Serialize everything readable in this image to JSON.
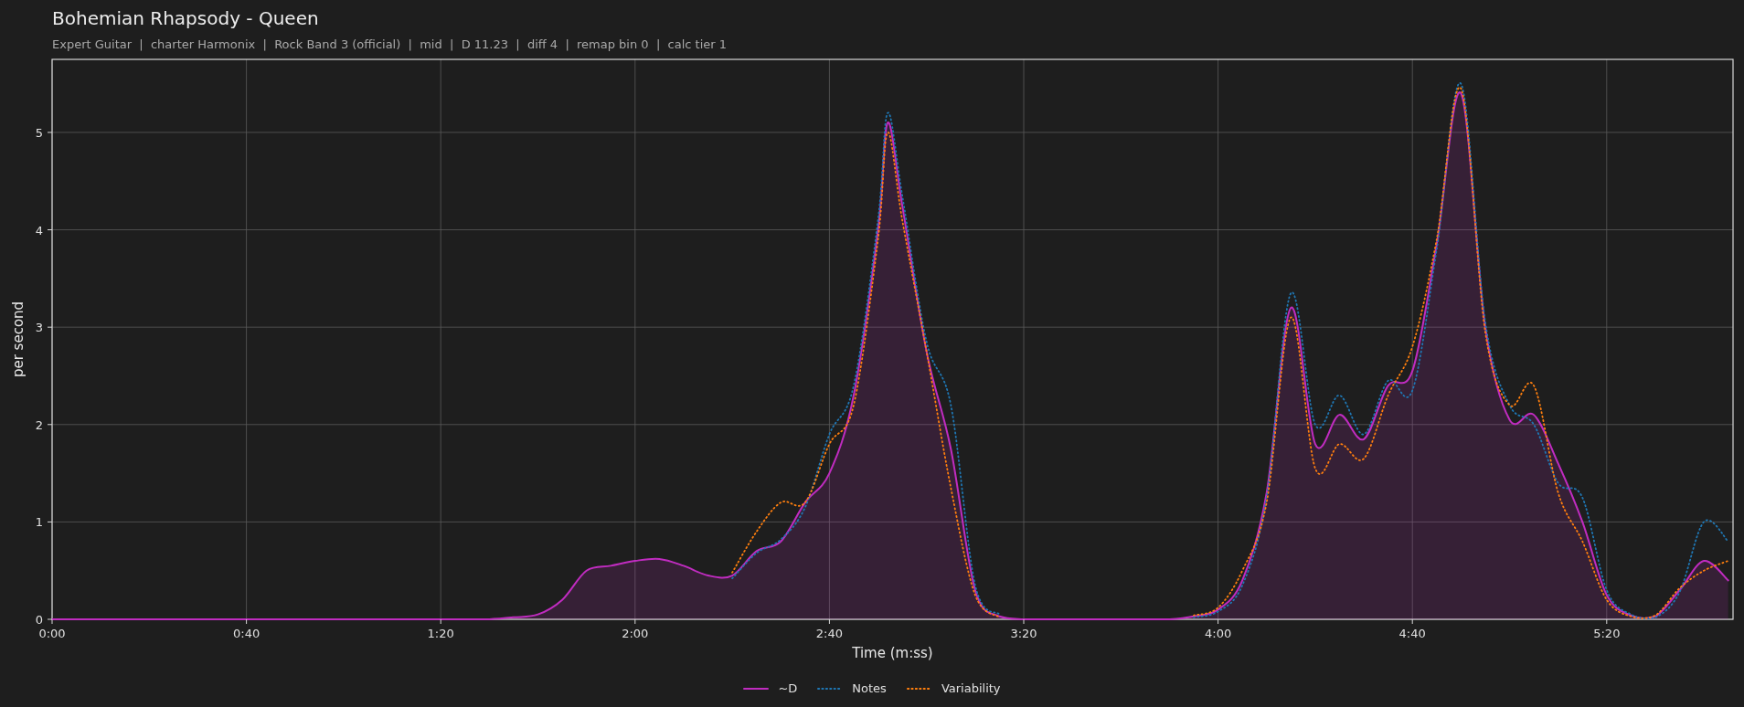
{
  "title": "Bohemian Rhapsody - Queen",
  "subtitle": "Expert Guitar  |  charter Harmonix  |  Rock Band 3 (official)  |  mid  |  D 11.23  |  diff 4  |  remap bin 0  |  calc tier 1",
  "chart_data": {
    "type": "line",
    "xlabel": "Time (m:ss)",
    "ylabel": "per second",
    "xlim": [
      0,
      346
    ],
    "ylim": [
      0,
      5.75
    ],
    "grid": true,
    "legend": true,
    "xticks": [
      {
        "value": 0,
        "label": "0:00"
      },
      {
        "value": 40,
        "label": "0:40"
      },
      {
        "value": 80,
        "label": "1:20"
      },
      {
        "value": 120,
        "label": "2:00"
      },
      {
        "value": 160,
        "label": "2:40"
      },
      {
        "value": 200,
        "label": "3:20"
      },
      {
        "value": 240,
        "label": "4:00"
      },
      {
        "value": 280,
        "label": "4:40"
      },
      {
        "value": 320,
        "label": "5:20"
      }
    ],
    "yticks": [
      0,
      1,
      2,
      3,
      4,
      5
    ],
    "x": [
      0,
      5,
      10,
      15,
      20,
      25,
      30,
      35,
      40,
      45,
      50,
      55,
      60,
      65,
      70,
      75,
      80,
      85,
      90,
      95,
      100,
      105,
      110,
      115,
      120,
      125,
      130,
      135,
      140,
      145,
      150,
      155,
      160,
      165,
      170,
      172,
      175,
      180,
      185,
      190,
      195,
      200,
      205,
      210,
      215,
      220,
      225,
      230,
      235,
      240,
      245,
      250,
      255,
      260,
      265,
      270,
      275,
      280,
      285,
      290,
      295,
      300,
      305,
      310,
      315,
      320,
      325,
      330,
      335,
      340,
      345
    ],
    "series": [
      {
        "name": "~D",
        "color": "#c02cc0",
        "line_style": "solid",
        "values": [
          0,
          0,
          0,
          0,
          0,
          0,
          0,
          0,
          0,
          0,
          0,
          0,
          0,
          0,
          0,
          0,
          0,
          0,
          0,
          0.02,
          0.05,
          0.2,
          0.5,
          0.55,
          0.6,
          0.62,
          0.55,
          0.45,
          0.45,
          0.7,
          0.8,
          1.2,
          1.5,
          2.3,
          4.0,
          5.1,
          4.25,
          2.75,
          1.75,
          0.3,
          0.03,
          0,
          0,
          0,
          0,
          0,
          0,
          0,
          0.03,
          0.1,
          0.4,
          1.3,
          3.2,
          1.8,
          2.1,
          1.85,
          2.4,
          2.55,
          3.85,
          5.4,
          3.0,
          2.05,
          2.1,
          1.6,
          1.0,
          0.25,
          0.04,
          0.03,
          0.3,
          0.6,
          0.4
        ]
      },
      {
        "name": "Notes",
        "color": "#1f77b4",
        "line_style": "dotted",
        "values": [
          null,
          null,
          null,
          null,
          null,
          null,
          null,
          null,
          null,
          null,
          null,
          null,
          null,
          null,
          null,
          null,
          null,
          null,
          null,
          null,
          null,
          null,
          null,
          null,
          null,
          null,
          null,
          null,
          0.42,
          0.68,
          0.82,
          1.15,
          1.9,
          2.4,
          4.1,
          5.2,
          4.35,
          2.85,
          2.2,
          0.35,
          0.05,
          null,
          null,
          null,
          null,
          null,
          null,
          null,
          0.02,
          0.08,
          0.35,
          1.25,
          3.35,
          2.0,
          2.3,
          1.9,
          2.45,
          2.35,
          3.8,
          5.5,
          3.05,
          2.2,
          2.0,
          1.4,
          1.25,
          0.3,
          0.05,
          0.02,
          0.28,
          1.0,
          0.8
        ]
      },
      {
        "name": "Variability",
        "color": "#ff7f0e",
        "line_style": "dotted",
        "values": [
          null,
          null,
          null,
          null,
          null,
          null,
          null,
          null,
          null,
          null,
          null,
          null,
          null,
          null,
          null,
          null,
          null,
          null,
          null,
          null,
          null,
          null,
          null,
          null,
          null,
          null,
          null,
          null,
          0.48,
          0.9,
          1.2,
          1.2,
          1.8,
          2.2,
          3.9,
          5.0,
          4.1,
          2.75,
          1.35,
          0.25,
          0.02,
          null,
          null,
          null,
          null,
          null,
          null,
          null,
          0.04,
          0.12,
          0.5,
          1.2,
          3.1,
          1.55,
          1.8,
          1.65,
          2.3,
          2.8,
          3.9,
          5.45,
          2.95,
          2.2,
          2.4,
          1.3,
          0.8,
          0.2,
          0.03,
          0.04,
          0.32,
          0.5,
          0.6
        ]
      }
    ]
  }
}
